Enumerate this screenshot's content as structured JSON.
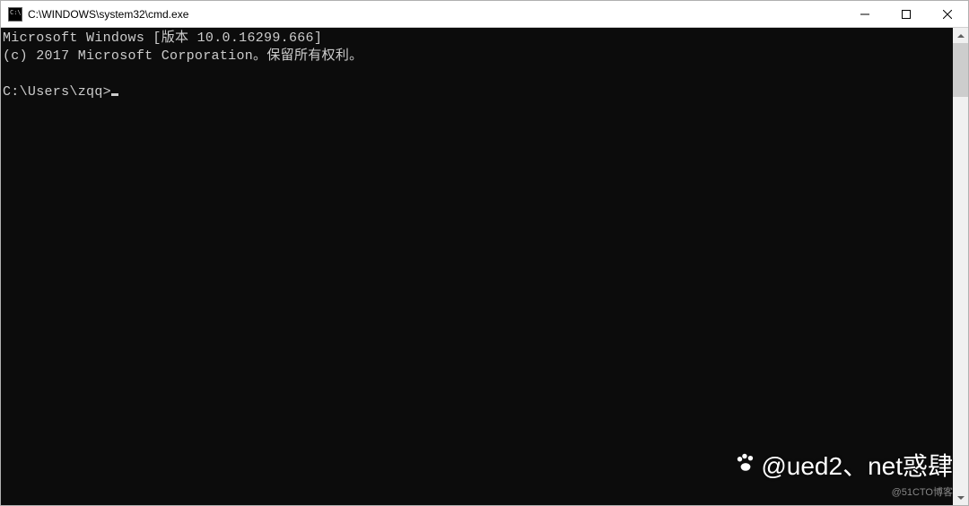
{
  "titlebar": {
    "title": "C:\\WINDOWS\\system32\\cmd.exe"
  },
  "console": {
    "line1": "Microsoft Windows [版本 10.0.16299.666]",
    "line2": "(c) 2017 Microsoft Corporation。保留所有权利。",
    "blank": "",
    "prompt": "C:\\Users\\zqq>"
  },
  "watermark": {
    "main": "@ued2、net惑肆",
    "sub": "@51CTO博客"
  }
}
